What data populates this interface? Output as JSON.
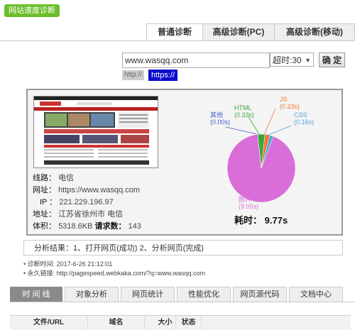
{
  "page_title": "网站速度诊断",
  "top_tabs": [
    {
      "label": "普通诊断",
      "active": true
    },
    {
      "label": "高级诊断(PC)",
      "active": false
    },
    {
      "label": "高级诊断(移动)",
      "active": false
    }
  ],
  "form": {
    "url_value": "www.wasqq.com",
    "timeout_selected": "超时:30",
    "confirm_label": "确 定",
    "protocol_http": "http://",
    "protocol_https": "https://"
  },
  "info": {
    "route_label": "线路：",
    "route_value": "电信",
    "url_label": "网址：",
    "url_value": "https://www.wasqq.com",
    "ip_label": "IP ：",
    "ip_value": "221.229.196.97",
    "address_label": "地址：",
    "address_value": "江苏省徐州市 电信",
    "size_label": "体积：",
    "size_value": "5318.6KB",
    "requests_label": "请求数：",
    "requests_value": "143"
  },
  "chart_data": {
    "type": "pie",
    "slices": [
      {
        "name": "图片",
        "value": 9.05,
        "label": "(9.05s)",
        "color": "#d96ed9"
      },
      {
        "name": "其他",
        "value": 0.0,
        "label": "(0.00s)",
        "color": "#4060d0"
      },
      {
        "name": "HTML",
        "value": 0.33,
        "label": "(0.33s)",
        "color": "#3aa63a"
      },
      {
        "name": "JS",
        "value": 0.23,
        "label": "(0.23s)",
        "color": "#ee7733"
      },
      {
        "name": "CSS",
        "value": 0.16,
        "label": "(0.16s)",
        "color": "#4ca6d8"
      }
    ],
    "total_label": "耗时：",
    "total_value": "9.77s"
  },
  "result": {
    "text": "分析结果：1、打开网页(成功) 2、分析网页(完成)"
  },
  "notes": {
    "diag_time": "• 诊断时间: 2017-6-26 21:12:01",
    "permalink": "• 永久链接: http://pagespeed.webkaka.com/?q=www.wasqq.com"
  },
  "bottom_tabs": [
    {
      "label": "时 间 线",
      "active": true
    },
    {
      "label": "对象分析",
      "active": false
    },
    {
      "label": "网页统计",
      "active": false
    },
    {
      "label": "性能优化",
      "active": false
    },
    {
      "label": "网页源代码",
      "active": false
    },
    {
      "label": "文档中心",
      "active": false
    }
  ],
  "table": {
    "headers": [
      "文件/URL",
      "域名",
      "大小",
      "状态"
    ]
  },
  "colors": {
    "accent_green": "#6abf2a",
    "https_badge": "#0a0acc",
    "active_tab_gray": "#8a8a8a"
  }
}
